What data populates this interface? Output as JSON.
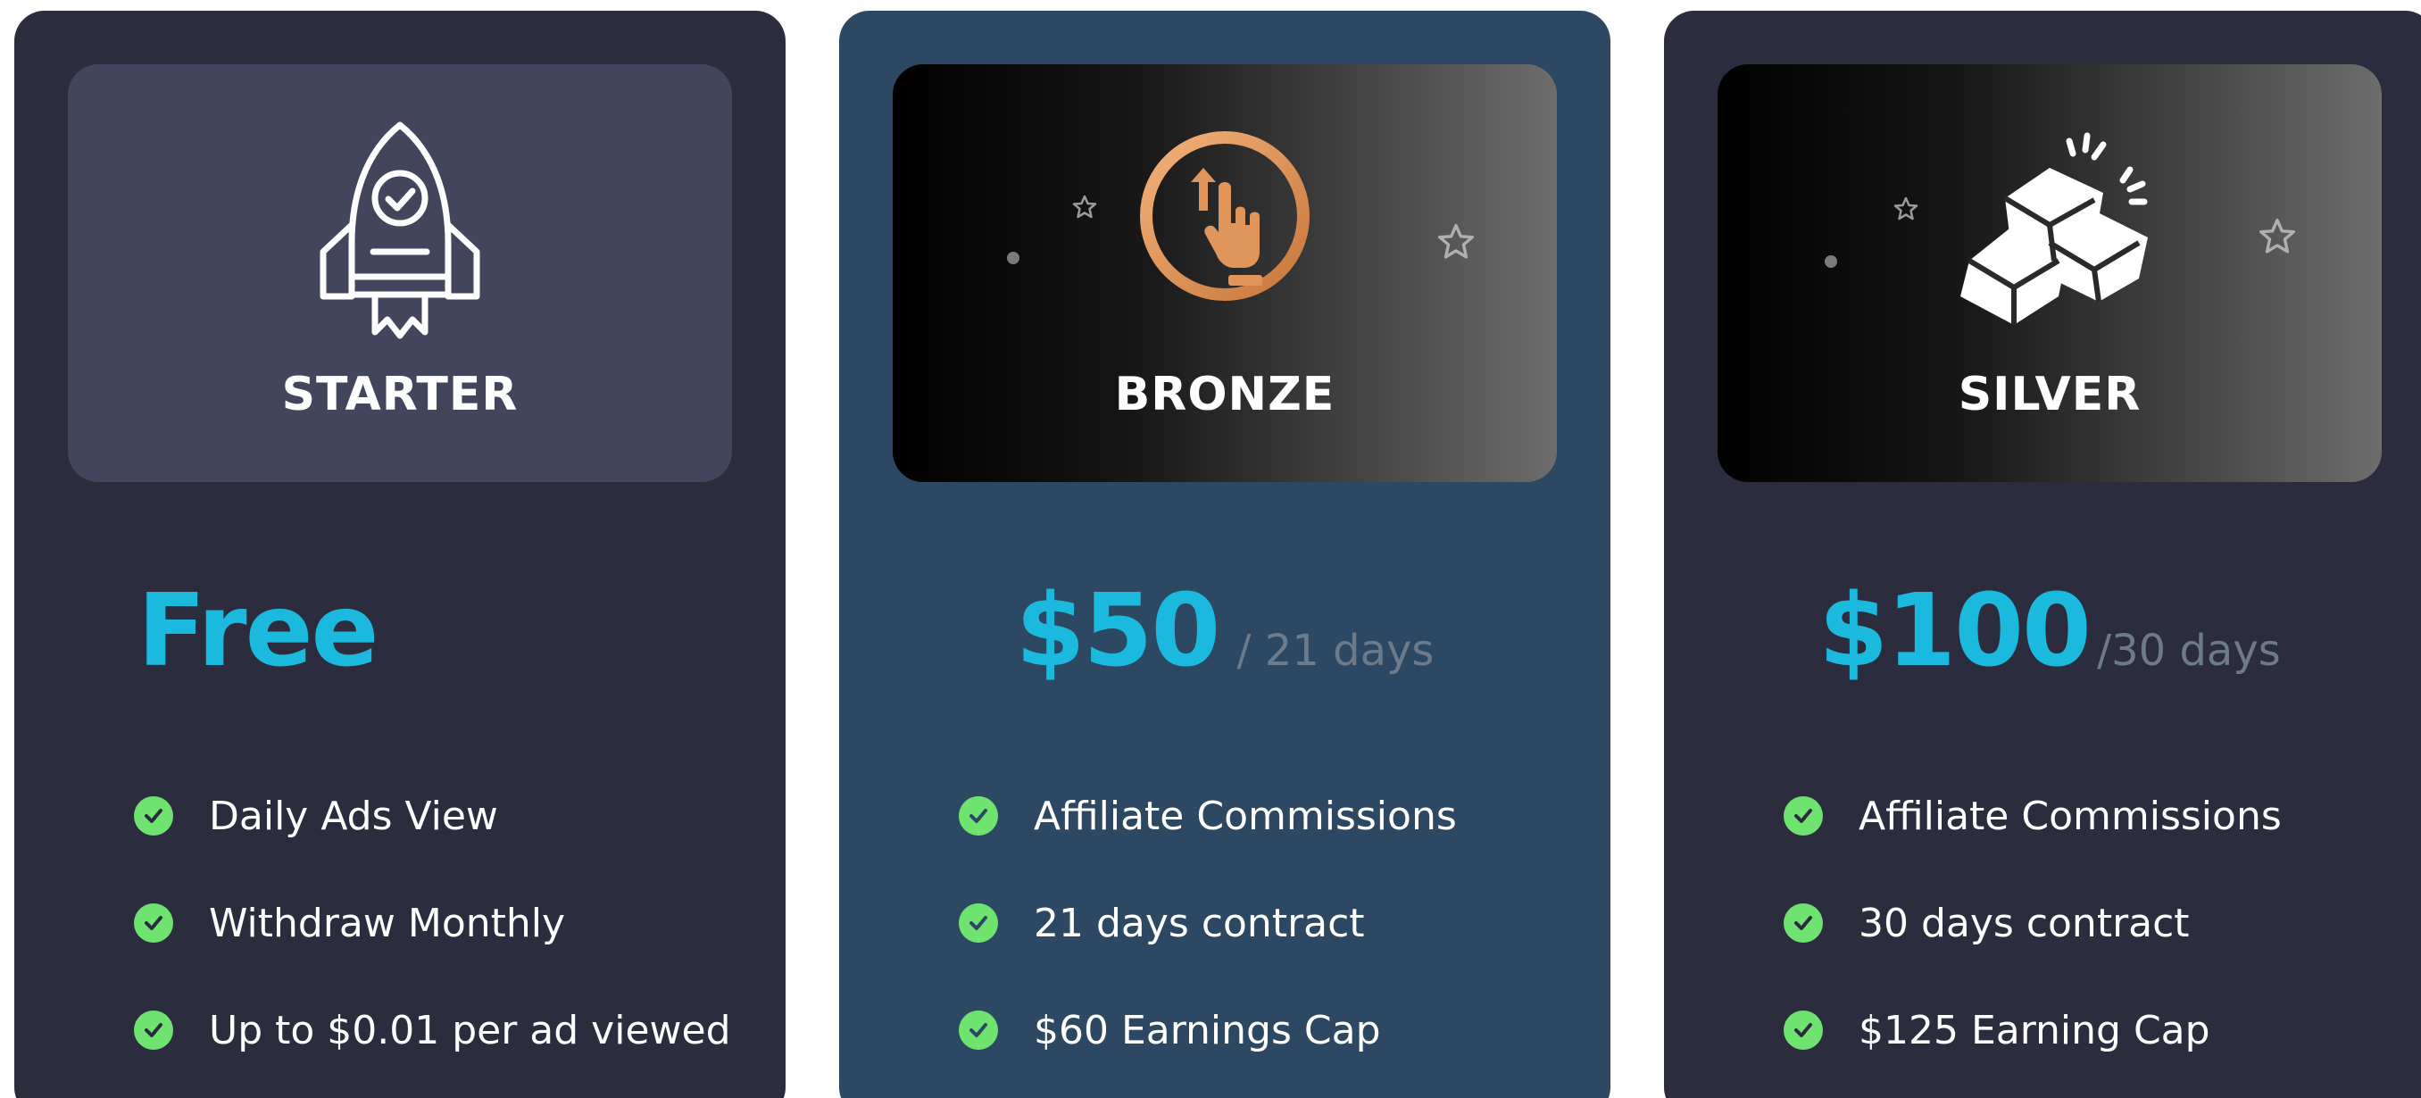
{
  "plans": [
    {
      "id": "starter",
      "name": "STARTER",
      "icon": "rocket-icon",
      "price": "Free",
      "period": "",
      "features": [
        "Daily Ads View",
        "Withdraw Monthly",
        "Up to $0.01 per ad viewed"
      ]
    },
    {
      "id": "bronze",
      "name": "BRONZE",
      "icon": "hand-tap-icon",
      "price": "$50",
      "period": "/ 21 days",
      "features": [
        "Affiliate Commissions",
        "21 days contract",
        "$60 Earnings Cap"
      ]
    },
    {
      "id": "silver",
      "name": "SILVER",
      "icon": "gold-bars-icon",
      "price": "$100",
      "period": "/30 days",
      "features": [
        "Affiliate Commissions",
        "30 days contract",
        "$125 Earning Cap"
      ]
    }
  ],
  "colors": {
    "card_dark": "#2b2c3d",
    "card_blue": "#2c4863",
    "price_accent": "#1bb9dd",
    "period_text": "#6d7a89",
    "check_green": "#6ee36f",
    "bronze_icon": "#e0955a"
  }
}
